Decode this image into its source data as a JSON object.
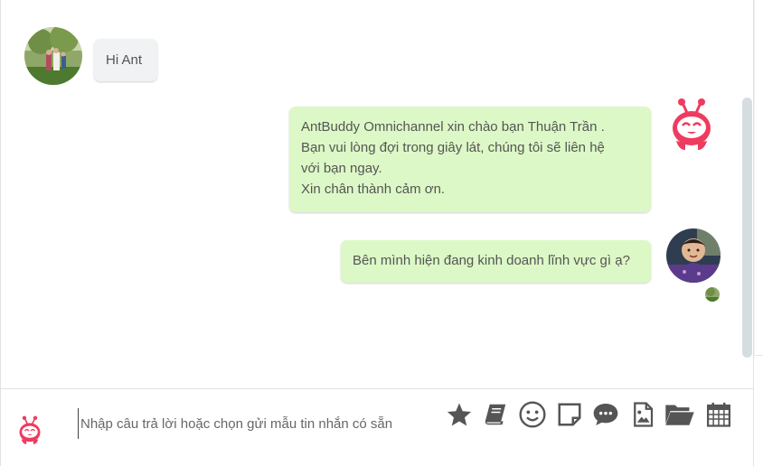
{
  "conversation": {
    "messages": [
      {
        "direction": "incoming",
        "text": "Hi Ant"
      },
      {
        "direction": "outgoing",
        "lines": [
          "AntBuddy Omnichannel xin chào bạn Thuận Trần .",
          "Bạn vui lòng đợi trong giây lát, chúng tôi sẽ liên hệ",
          "với bạn ngay.",
          "Xin chân thành cảm ơn."
        ]
      },
      {
        "direction": "outgoing",
        "text": "Bên mình hiện đang kinh doanh lĩnh vực gì ạ?"
      }
    ]
  },
  "composer": {
    "placeholder": "Nhập câu trả lời hoặc chọn gửi mẫu tin nhắn có sẵn",
    "tools": [
      "star-icon",
      "book-icon",
      "smiley-icon",
      "note-icon",
      "chat-bubbles-icon",
      "image-file-icon",
      "folder-open-icon",
      "calendar-icon"
    ]
  },
  "colors": {
    "incoming_bubble": "#f0f2f3",
    "outgoing_bubble": "#dcf8c6",
    "brand_pink": "#ee3b5e",
    "icon_gray": "#555555"
  }
}
